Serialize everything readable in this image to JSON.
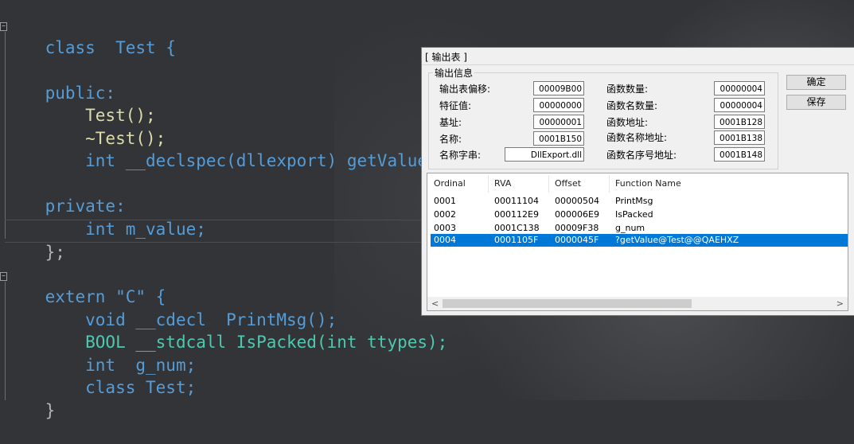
{
  "code": [
    "class  Test {",
    "",
    "public:",
    "    Test();",
    "    ~Test();",
    "    int __declspec(dllexport) getValue();",
    "",
    "private:",
    "    int m_value;",
    "};",
    "",
    "extern \"C\" {",
    "    void __cdecl  PrintMsg();",
    "    BOOL __stdcall IsPacked(int ttypes);",
    "    int  g_num;",
    "    class Test;",
    "}"
  ],
  "dialog": {
    "title": "[ 输出表 ]",
    "group_label": "输出信息",
    "fields_left": [
      {
        "label": "输出表偏移:",
        "value": "00009B00"
      },
      {
        "label": "特征值:",
        "value": "00000000"
      },
      {
        "label": "基址:",
        "value": "00000001"
      },
      {
        "label": "名称:",
        "value": "0001B150"
      },
      {
        "label": "名称字串:",
        "value": "DllExport.dll"
      }
    ],
    "fields_right": [
      {
        "label": "函数数量:",
        "value": "00000004"
      },
      {
        "label": "函数名数量:",
        "value": "00000004"
      },
      {
        "label": "函数地址:",
        "value": "0001B128"
      },
      {
        "label": "函数名称地址:",
        "value": "0001B138"
      },
      {
        "label": "函数名序号地址:",
        "value": "0001B148"
      }
    ],
    "ok_button": "确定",
    "save_button": "保存",
    "columns": [
      "Ordinal",
      "RVA",
      "Offset",
      "Function Name"
    ],
    "rows": [
      {
        "ordinal": "0001",
        "rva": "00011104",
        "offset": "00000504",
        "name": "PrintMsg"
      },
      {
        "ordinal": "0002",
        "rva": "000112E9",
        "offset": "000006E9",
        "name": "IsPacked"
      },
      {
        "ordinal": "0003",
        "rva": "0001C138",
        "offset": "00009F38",
        "name": "g_num"
      },
      {
        "ordinal": "0004",
        "rva": "0001105F",
        "offset": "0000045F",
        "name": "?getValue@Test@@QAEHXZ"
      }
    ],
    "selected_row": 3,
    "scroll_left_icon": "chevron-left-icon",
    "scroll_right_icon": "chevron-right-icon"
  }
}
